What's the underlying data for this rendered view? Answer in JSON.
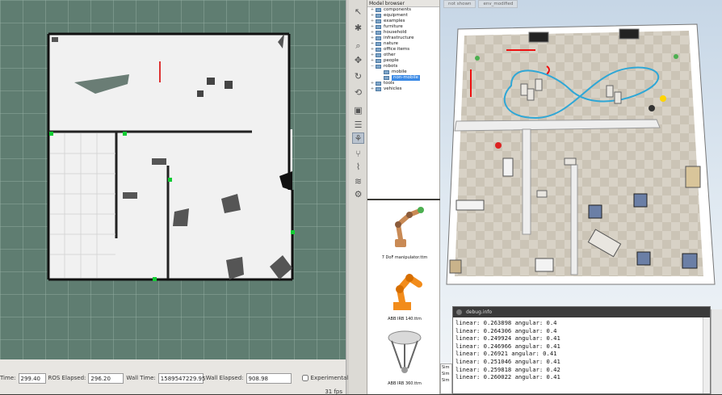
{
  "rviz": {
    "time": {
      "ros_time_label": "Time:",
      "ros_time": "299.40",
      "ros_elapsed_label": "ROS Elapsed:",
      "ros_elapsed": "296.20",
      "wall_time_label": "Wall Time:",
      "wall_time": "1589547229.95",
      "wall_elapsed_label": "Wall Elapsed:",
      "wall_elapsed": "908.98",
      "experimental_label": "Experimental"
    },
    "fps": "31 fps"
  },
  "model_browser": {
    "title": "Model browser",
    "items": [
      {
        "label": "components",
        "expanded": false,
        "depth": 0
      },
      {
        "label": "equipment",
        "expanded": false,
        "depth": 0
      },
      {
        "label": "examples",
        "expanded": false,
        "depth": 0
      },
      {
        "label": "furniture",
        "expanded": false,
        "depth": 0
      },
      {
        "label": "household",
        "expanded": false,
        "depth": 0
      },
      {
        "label": "infrastructure",
        "expanded": false,
        "depth": 0
      },
      {
        "label": "nature",
        "expanded": false,
        "depth": 0
      },
      {
        "label": "office items",
        "expanded": false,
        "depth": 0
      },
      {
        "label": "other",
        "expanded": false,
        "depth": 0
      },
      {
        "label": "people",
        "expanded": false,
        "depth": 0
      },
      {
        "label": "robots",
        "expanded": true,
        "depth": 0
      },
      {
        "label": "mobile",
        "expanded": false,
        "depth": 1
      },
      {
        "label": "non-mobile",
        "expanded": false,
        "depth": 1,
        "selected": true
      },
      {
        "label": "tools",
        "expanded": false,
        "depth": 0
      },
      {
        "label": "vehicles",
        "expanded": false,
        "depth": 0
      }
    ],
    "models": [
      {
        "name": "7 DoF manipulator.ttm"
      },
      {
        "name": "ABB IRB 140.ttm"
      },
      {
        "name": "ABB IRB 360.ttm"
      }
    ]
  },
  "scene": {
    "tabs": [
      "not shown",
      "env_modified"
    ]
  },
  "debug": {
    "title": "debug.info",
    "lines": [
      "linear: 0.263898 angular: 0.4",
      "linear: 0.264306 angular: 0.4",
      "linear: 0.249924 angular: 0.41",
      "linear: 0.246966 angular: 0.41",
      "linear: 0.26921 angular: 0.41",
      "linear: 0.251046 angular: 0.41",
      "linear: 0.259818 angular: 0.42",
      "linear: 0.260022 angular: 0.41"
    ]
  },
  "side_stub": [
    "Sim",
    "Sim",
    "Sim"
  ],
  "toolbar_icons": [
    "arrow-icon",
    "cog-icon",
    "search-icon",
    "move-icon",
    "rotate-icon",
    "sync-icon",
    "camera-icon",
    "list-icon",
    "hierarchy-icon",
    "branch-icon",
    "path-icon",
    "robot-icon",
    "layers-icon",
    "layers-icon",
    "layers-icon",
    "gears-icon"
  ],
  "colors": {
    "map_background": "#5f7d71",
    "path": "#2fa7d6",
    "selected": "#3b8ae6"
  }
}
